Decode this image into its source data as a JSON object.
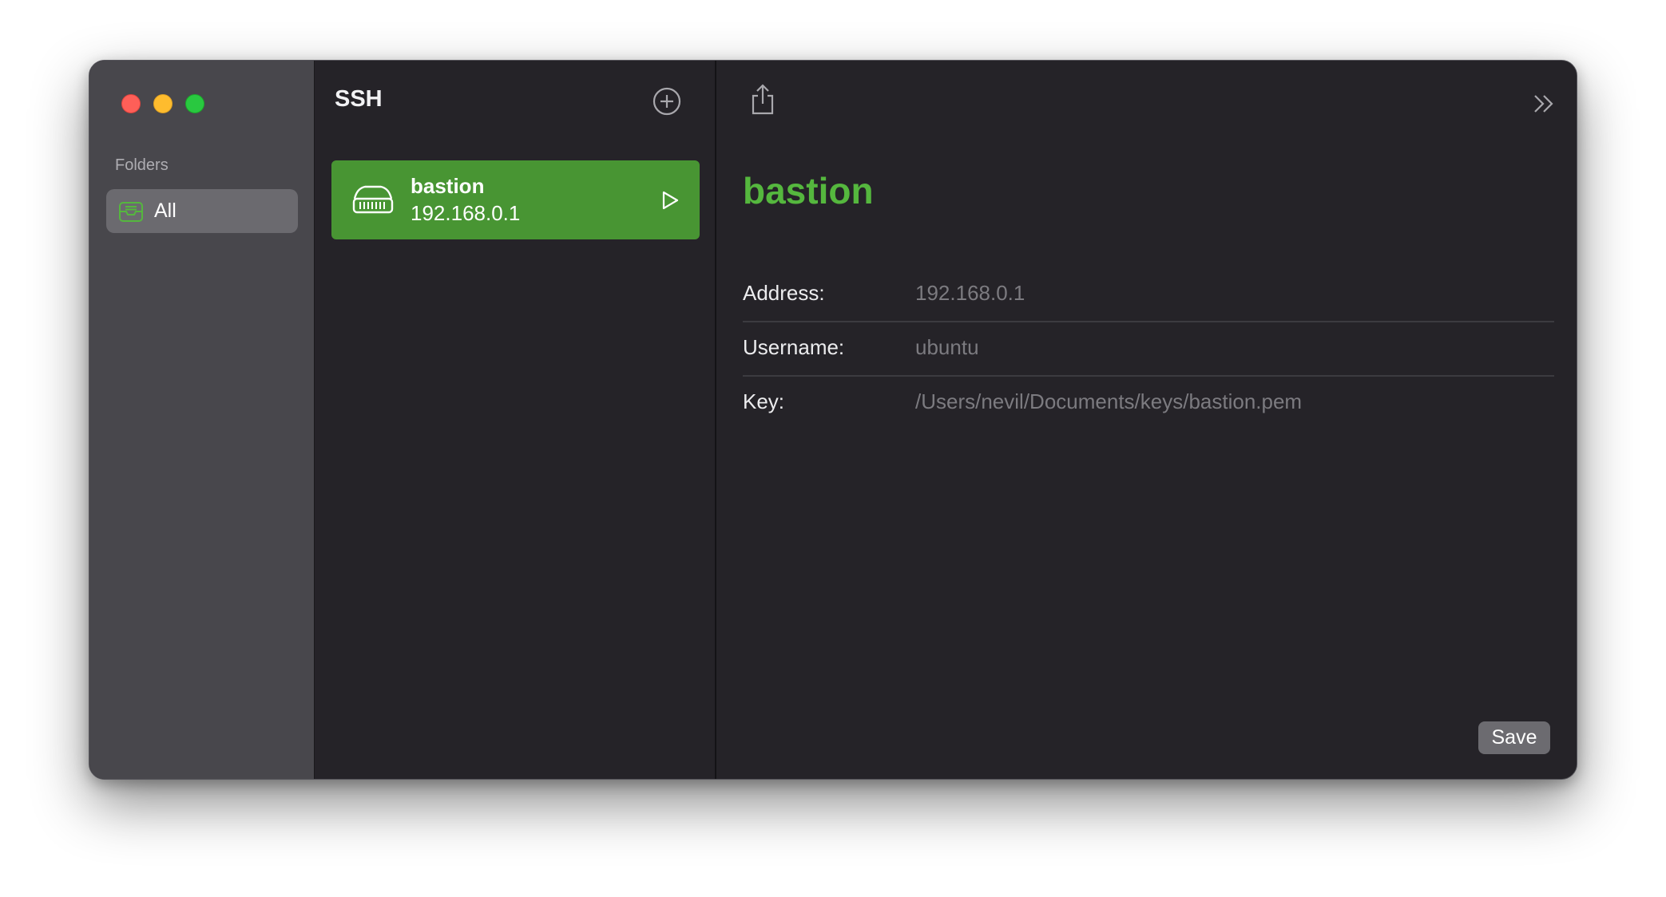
{
  "sidebar": {
    "section_label": "Folders",
    "folders": [
      {
        "label": "All",
        "icon": "tray-icon",
        "selected": true
      }
    ]
  },
  "list": {
    "title": "SSH",
    "add_icon": "plus-circle-icon",
    "items": [
      {
        "name": "bastion",
        "address": "192.168.0.1",
        "icon": "server-icon",
        "selected": true
      }
    ]
  },
  "detail": {
    "title": "bastion",
    "fields": [
      {
        "label": "Address:",
        "value": "192.168.0.1"
      },
      {
        "label": "Username:",
        "value": "ubuntu"
      },
      {
        "label": "Key:",
        "value": "/Users/nevil/Documents/keys/bastion.pem"
      }
    ],
    "save_label": "Save",
    "share_icon": "share-icon",
    "expand_icon": "chevron-double-right-icon"
  },
  "colors": {
    "accent": "#489533",
    "title_accent": "#55b73e",
    "sidebar_bg": "#48474c",
    "content_bg": "#252328"
  }
}
